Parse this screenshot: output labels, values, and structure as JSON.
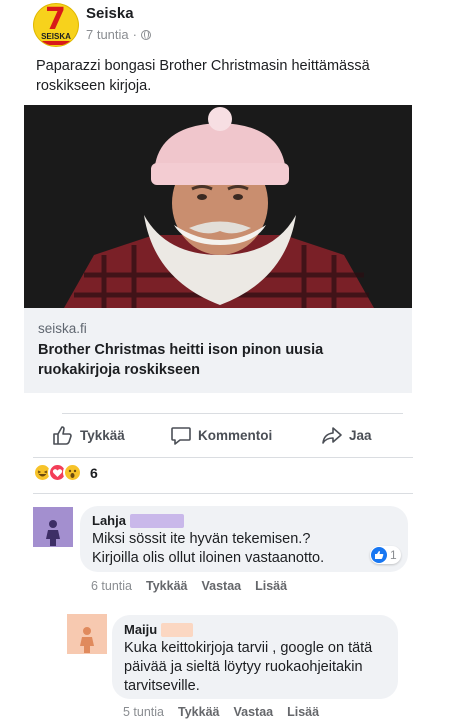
{
  "colors": {
    "reply_avatar_1": "#a38fcf",
    "reply_avatar_2": "#f7c9b0",
    "redact_1": "#c9b8ea",
    "redact_2": "#fbd7c2",
    "like_blue": "#1877f2"
  },
  "post": {
    "page_name": "Seiska",
    "logo_text": "SEISKA",
    "time": "7 tuntia",
    "separator": "·",
    "privacy_icon": "globe-icon",
    "text": "Paparazzi bongasi Brother Christmasin heittämässä roskikseen kirjoja."
  },
  "link": {
    "domain": "seiska.fi",
    "title": "Brother Christmas heitti ison pinon uusia ruokakirjoja roskikseen"
  },
  "actions": {
    "like_label": "Tykkää",
    "comment_label": "Kommentoi",
    "share_label": "Jaa"
  },
  "reactions": {
    "icons": [
      "haha-icon",
      "love-icon",
      "wow-icon"
    ],
    "count": "6"
  },
  "comments": [
    {
      "author": "Lahja",
      "text_line1": "Miksi sössit ite hyvän tekemisen.?",
      "text_line2": "Kirjoilla olis ollut iloinen vastaanotto.",
      "time": "6 tuntia",
      "like_label": "Tykkää",
      "reply_label": "Vastaa",
      "more_label": "Lisää",
      "likes": "1"
    },
    {
      "author": "Maiju",
      "text_line1": "Kuka keittokirjoja tarvii , google on tätä",
      "text_line2": "päivää ja sieltä löytyy ruokaohjeitakin",
      "text_line3": "tarvitseville.",
      "time": "5 tuntia",
      "like_label": "Tykkää",
      "reply_label": "Vastaa",
      "more_label": "Lisää"
    }
  ]
}
